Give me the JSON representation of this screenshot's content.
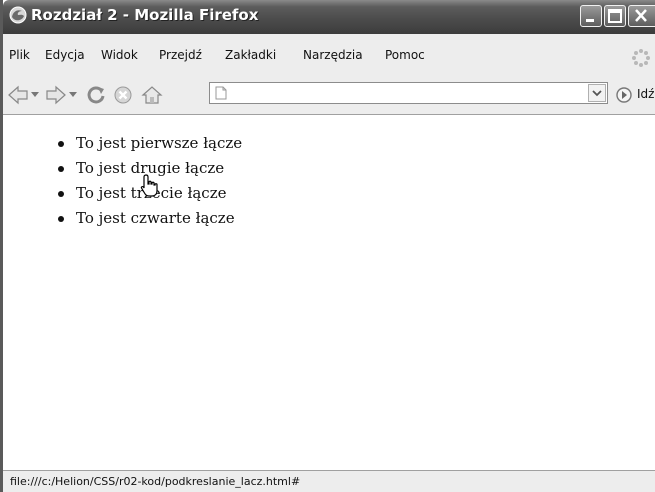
{
  "window": {
    "title": "Rozdział 2 - Mozilla Firefox"
  },
  "menu": {
    "items": [
      {
        "label": "Plik"
      },
      {
        "label": "Edycja"
      },
      {
        "label": "Widok"
      },
      {
        "label": "Przejdź"
      },
      {
        "label": "Zakładki"
      },
      {
        "label": "Narzędzia"
      },
      {
        "label": "Pomoc"
      }
    ]
  },
  "navbar": {
    "url_value": "",
    "go_label": "Idź",
    "icons": [
      "back-icon",
      "forward-icon",
      "reload-icon",
      "stop-icon",
      "home-icon"
    ]
  },
  "content": {
    "links": [
      {
        "text": "To jest pierwsze łącze"
      },
      {
        "text": "To jest drugie łącze"
      },
      {
        "text": "To jest trzecie łącze"
      },
      {
        "text": "To jest czwarte łącze"
      }
    ]
  },
  "status": {
    "text": "file:///c:/Helion/CSS/r02-kod/podkreslanie_lacz.html#"
  }
}
